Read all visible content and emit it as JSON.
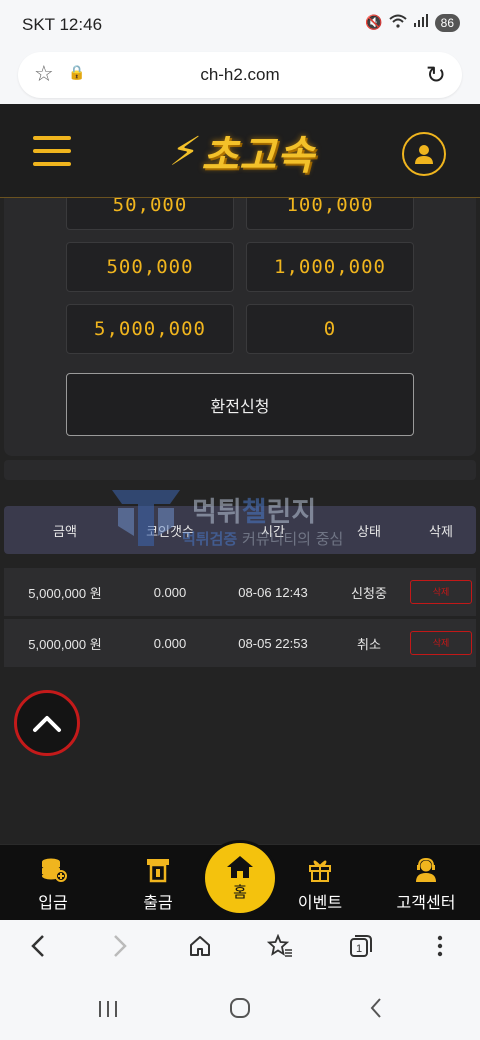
{
  "status": {
    "carrier_time": "SKT 12:46",
    "battery": "86"
  },
  "browser": {
    "url": "ch-h2.com"
  },
  "header": {
    "logo_text": "초고속"
  },
  "amounts": {
    "a1": "50,000",
    "a2": "100,000",
    "a3": "500,000",
    "a4": "1,000,000",
    "a5": "5,000,000",
    "a6": "0"
  },
  "apply_button": "환전신청",
  "table": {
    "headers": [
      "금액",
      "코인갯수",
      "시간",
      "상태",
      "삭제"
    ],
    "rows": [
      {
        "amount": "5,000,000 원",
        "coins": "0.000",
        "time": "08-06 12:43",
        "status": "신청중",
        "delete": "삭제"
      },
      {
        "amount": "5,000,000 원",
        "coins": "0.000",
        "time": "08-05 22:53",
        "status": "취소",
        "delete": "삭제"
      }
    ]
  },
  "watermark": {
    "title_a": "먹튀",
    "title_b": "챌",
    "title_c": "린지",
    "sub_a": "먹튀검증",
    "sub_b": " 커뮤니티의 중심"
  },
  "bottom_nav": {
    "deposit": "입금",
    "withdraw": "출금",
    "home": "홈",
    "event": "이벤트",
    "support": "고객센터"
  },
  "browser_toolbar": {
    "tabs_count": "1"
  },
  "colors": {
    "accent": "#f0b51e",
    "danger": "#c21818",
    "header_bg": "#1e1e1e",
    "table_head_bg": "#3a3a4c"
  }
}
